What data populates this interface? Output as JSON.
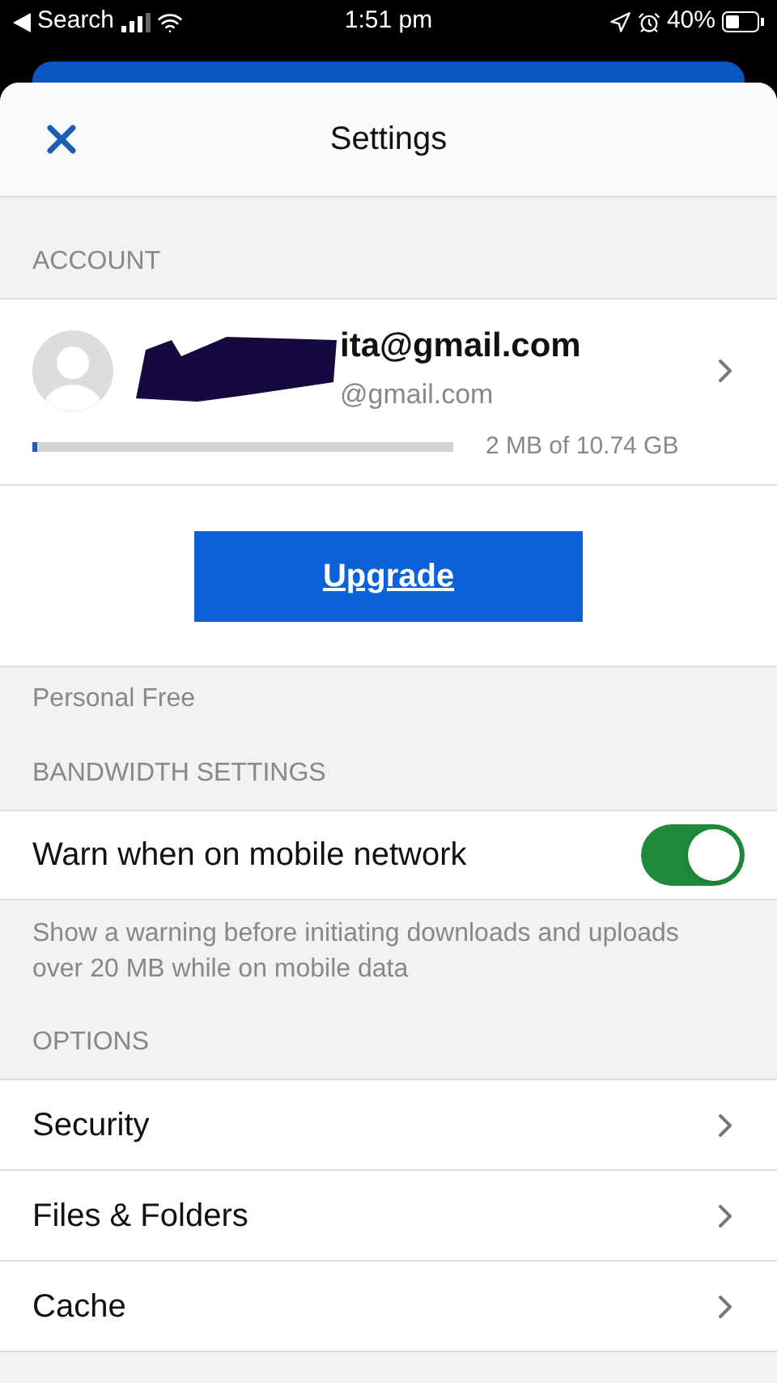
{
  "status_bar": {
    "back_label": "Search",
    "time": "1:51 pm",
    "battery": "40%"
  },
  "header": {
    "title": "Settings"
  },
  "account": {
    "section_title": "ACCOUNT",
    "name_visible": "ita@gmail.com",
    "email_visible": "@gmail.com",
    "storage": {
      "level": 0.01,
      "reading": "2 MB of 10.74 GB"
    },
    "upgrade_button": "Upgrade",
    "plan": "Personal Free"
  },
  "bandwidth": {
    "section_title": "BANDWIDTH SETTINGS",
    "toggle": {
      "label": "Warn when on mobile network",
      "on": true
    },
    "note": "Show a warning before initiating downloads and uploads over 20 MB while on mobile data"
  },
  "options": {
    "section_title": "OPTIONS",
    "items": [
      {
        "label": "Security"
      },
      {
        "label": "Files & Folders"
      },
      {
        "label": "Cache"
      }
    ]
  }
}
